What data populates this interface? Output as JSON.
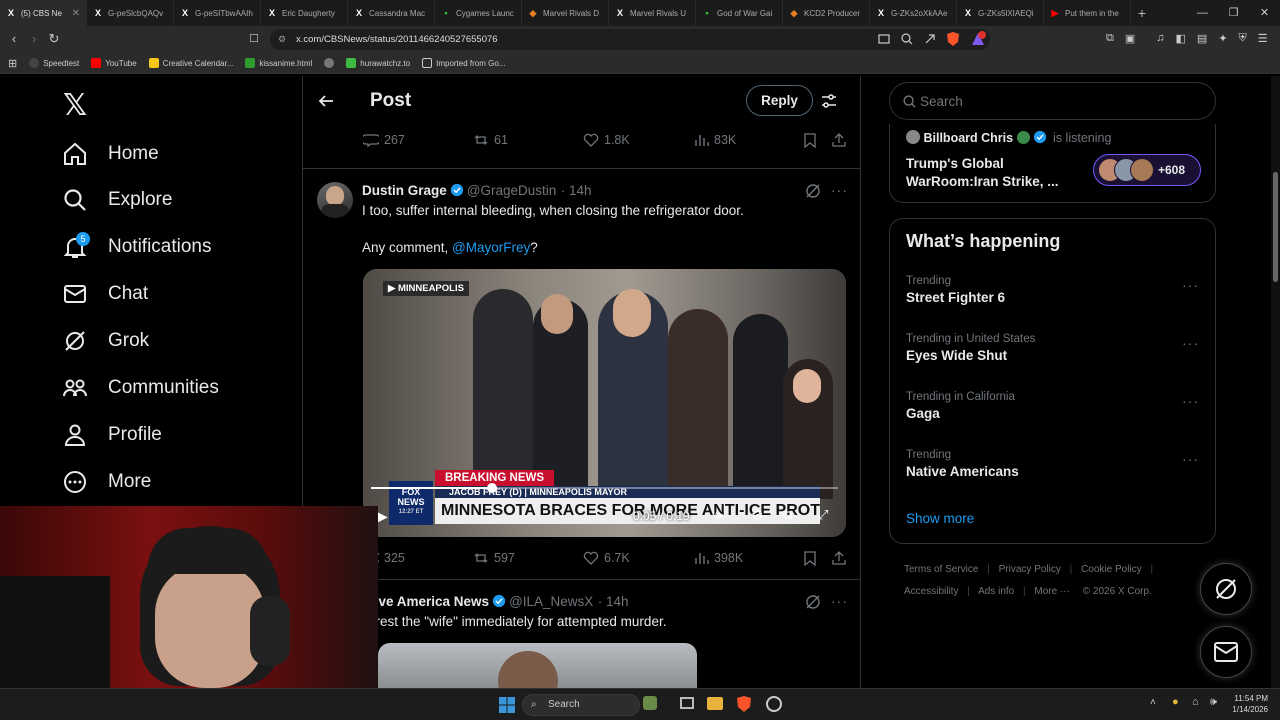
{
  "browser": {
    "tabs": [
      {
        "label": "(5) CBS Ne",
        "icon": "x-icon",
        "active": true
      },
      {
        "label": "G-peSlcbQAQv",
        "icon": "x-icon"
      },
      {
        "label": "G-peSITbwAAIh",
        "icon": "x-icon"
      },
      {
        "label": "Eric Daugherty",
        "icon": "x-icon"
      },
      {
        "label": "Cassandra Mac",
        "icon": "x-icon"
      },
      {
        "label": "Cygames Launc",
        "icon": "green-icon"
      },
      {
        "label": "Marvel Rivals D",
        "icon": "orange-icon"
      },
      {
        "label": "Marvel Rivals U",
        "icon": "x-icon"
      },
      {
        "label": "God of War Gai",
        "icon": "green-icon"
      },
      {
        "label": "KCD2 Producer",
        "icon": "orange-icon"
      },
      {
        "label": "G-ZKs2oXkAAe",
        "icon": "x-icon"
      },
      {
        "label": "G-ZKs5lXIAEQi",
        "icon": "x-icon"
      },
      {
        "label": "Put them in the",
        "icon": "youtube-icon"
      }
    ],
    "new_tab": "+",
    "url": "x.com/CBSNews/status/2011466240527655076",
    "bookmarks": [
      "Speedtest",
      "YouTube",
      "Creative Calendar...",
      "kissanime.html",
      "",
      "hurawatchz.to",
      "Imported from Go..."
    ]
  },
  "nav": {
    "items": [
      {
        "label": "Home",
        "icon": "home-icon"
      },
      {
        "label": "Explore",
        "icon": "search-icon"
      },
      {
        "label": "Notifications",
        "icon": "bell-icon",
        "badge": "5"
      },
      {
        "label": "Chat",
        "icon": "mail-icon"
      },
      {
        "label": "Grok",
        "icon": "grok-icon"
      },
      {
        "label": "Communities",
        "icon": "communities-icon"
      },
      {
        "label": "Profile",
        "icon": "profile-icon"
      },
      {
        "label": "More",
        "icon": "more-icon"
      }
    ]
  },
  "header": {
    "title": "Post",
    "reply_label": "Reply"
  },
  "top_actions": {
    "replies": "267",
    "reposts": "61",
    "likes": "1.8K",
    "views": "83K"
  },
  "tweet1": {
    "name": "Dustin Grage",
    "handle": "@GrageDustin",
    "time": "· 14h",
    "text": "I too, suffer internal bleeding, when closing the refrigerator door.",
    "line2_prefix": "Any comment, ",
    "mention": "@MayorFrey",
    "line2_suffix": "?",
    "video": {
      "location_tag": "MINNEAPOLIS",
      "breaking": "BREAKING NEWS",
      "lower_third_name": "JACOB FREY (D) | MINNEAPOLIS MAYOR",
      "headline": "MINNESOTA BRACES FOR MORE ANTI-ICE PROTESTS",
      "network": "FOX NEWS",
      "clock": "12:27 ET",
      "time": "0:05 / 0:19",
      "progress": 0.26
    },
    "actions": {
      "replies": "325",
      "reposts": "597",
      "likes": "6.7K",
      "views": "398K"
    }
  },
  "tweet2": {
    "name": "Love America News",
    "handle": "@ILA_NewsX",
    "time": "· 14h",
    "text": "Arrest the \"wife\" immediately for attempted murder."
  },
  "right": {
    "search_placeholder": "Search",
    "space": {
      "host": "Billboard Chris",
      "status": "is listening",
      "title_line1": "Trump's Global",
      "title_line2": "WarRoom:Iran Strike, ...",
      "listeners": "+608"
    },
    "happening_title": "What’s happening",
    "trends": [
      {
        "context": "Trending",
        "title": "Street Fighter 6"
      },
      {
        "context": "Trending in United States",
        "title": "Eyes Wide Shut"
      },
      {
        "context": "Trending in California",
        "title": "Gaga"
      },
      {
        "context": "Trending",
        "title": "Native Americans"
      }
    ],
    "show_more": "Show more",
    "footer": {
      "line1": [
        "Terms of Service",
        "Privacy Policy",
        "Cookie Policy"
      ],
      "line2": [
        "Accessibility",
        "Ads info",
        "More ···",
        "© 2026 X Corp."
      ]
    }
  },
  "taskbar": {
    "search_placeholder": "Search",
    "time": "11:54 PM",
    "date": "1/14/2026"
  },
  "colors": {
    "accent": "#1d9bf0",
    "bg": "#000000",
    "border": "#2f3336",
    "muted": "#71767b"
  }
}
